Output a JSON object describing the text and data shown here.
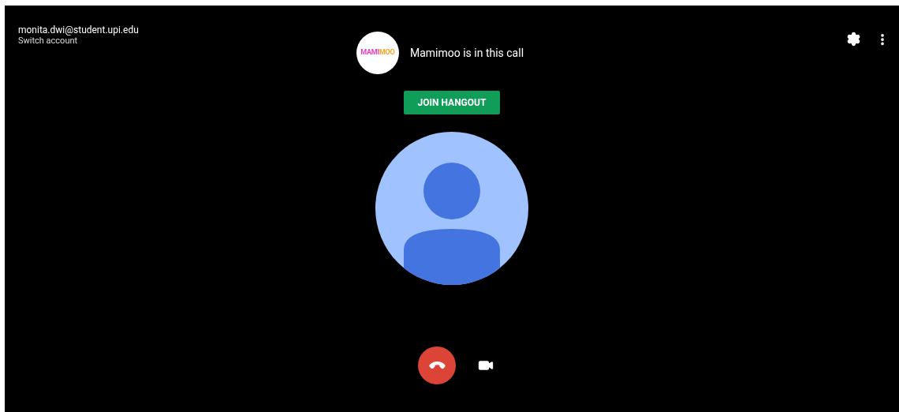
{
  "account": {
    "email": "monita.dwi@student.upi.edu",
    "switch_label": "Switch account"
  },
  "caller": {
    "logo_parts": [
      "MAMI",
      "MOO"
    ],
    "status": "Mamimoo is in this call"
  },
  "join_button": "JOIN HANGOUT"
}
